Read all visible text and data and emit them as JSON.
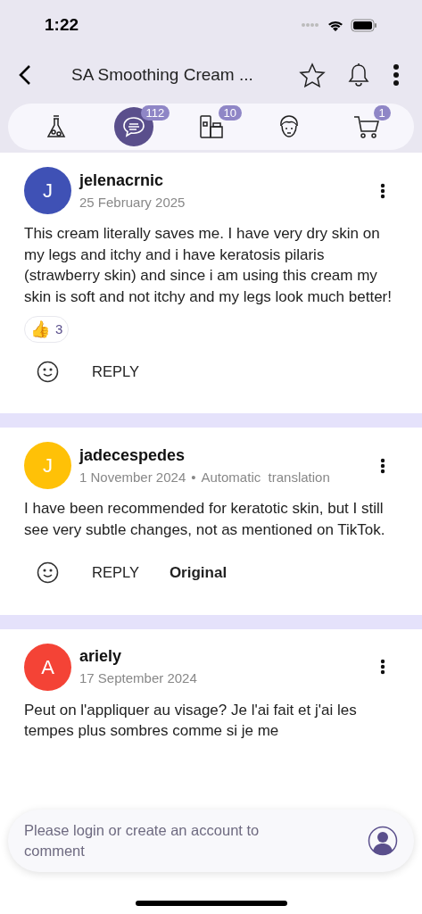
{
  "status_bar": {
    "time": "1:22"
  },
  "header": {
    "title": "SA Smoothing Cream ..."
  },
  "tabs": [
    {
      "kind": "flask",
      "selected": false
    },
    {
      "kind": "comments",
      "badge": "112",
      "selected": true
    },
    {
      "kind": "products",
      "badge": "10",
      "selected": false
    },
    {
      "kind": "face",
      "selected": false
    },
    {
      "kind": "cart",
      "badge": "1",
      "selected": false
    }
  ],
  "comments": [
    {
      "initial": "J",
      "color": "#3f51b5",
      "user": "jelenacrnic",
      "date": "25 February 2025",
      "text": "This cream literally saves me. I have very dry skin on my legs and itchy and i have keratosis pilaris (strawberry skin) and since i am using this cream my skin is soft and not itchy and my legs look much better!",
      "reaction": {
        "emoji": "👍",
        "count": "3"
      },
      "reply": "REPLY"
    },
    {
      "initial": "J",
      "color": "#ffc107",
      "user": "jadecespedes",
      "date": "1 November 2024",
      "separator": "•",
      "note": "Automatic  translation",
      "text": "I have been recommended for keratotic skin, but I still see very subtle changes, not as mentioned on TikTok.",
      "reply": "REPLY",
      "original": "Original"
    },
    {
      "initial": "A",
      "color": "#f44336",
      "user": "ariely",
      "date": "17 September 2024",
      "text": "Peut on l'appliquer au visage? Je l'ai fait et j'ai les tempes plus sombres comme si je me"
    }
  ],
  "comment_box": {
    "placeholder": "Please login or create an account to comment"
  }
}
